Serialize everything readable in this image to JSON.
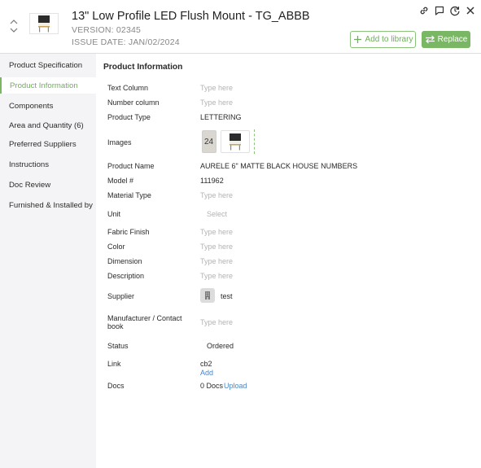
{
  "header": {
    "title": "13\" Low Profile LED Flush Mount - TG_ABBB",
    "version": "VERSION: 02345",
    "issue_date": "ISSUE DATE: JAN/02/2024",
    "add_to_library_label": "Add to library",
    "replace_label": "Replace"
  },
  "sidebar": {
    "items": [
      {
        "label": "Product Specification"
      },
      {
        "label": "Product Information"
      },
      {
        "label": "Components"
      },
      {
        "label": "Area and Quantity (6)"
      },
      {
        "label": "Preferred Suppliers"
      },
      {
        "label": "Instructions"
      },
      {
        "label": "Doc Review"
      },
      {
        "label": "Furnished & Installed by"
      }
    ],
    "active_index": 1
  },
  "main": {
    "section_title": "Product Information",
    "fields": {
      "text_column": {
        "label": "Text Column",
        "placeholder": "Type here"
      },
      "number_column": {
        "label": "Number column",
        "placeholder": "Type here"
      },
      "product_type": {
        "label": "Product Type",
        "value": "LETTERING"
      },
      "images": {
        "label": "Images",
        "image1_text": "24"
      },
      "product_name": {
        "label": "Product Name",
        "value": "AURELE 6\" MATTE BLACK HOUSE NUMBERS"
      },
      "model": {
        "label": "Model #",
        "value": "111962"
      },
      "material_type": {
        "label": "Material Type",
        "placeholder": "Type here"
      },
      "unit": {
        "label": "Unit",
        "placeholder": "Select"
      },
      "fabric_finish": {
        "label": "Fabric Finish",
        "placeholder": "Type here"
      },
      "color": {
        "label": "Color",
        "placeholder": "Type here"
      },
      "dimension": {
        "label": "Dimension",
        "placeholder": "Type here"
      },
      "description": {
        "label": "Description",
        "placeholder": "Type here"
      },
      "supplier": {
        "label": "Supplier",
        "value": "test"
      },
      "manufacturer": {
        "label_line1": "Manufacturer / Contact",
        "label_line2": "book",
        "placeholder": "Type here"
      },
      "status": {
        "label": "Status",
        "value": "Ordered"
      },
      "link": {
        "label": "Link",
        "value": "cb2",
        "add_label": "Add"
      },
      "docs": {
        "label": "Docs",
        "value": "0 Docs",
        "upload_label": "Upload"
      }
    }
  },
  "colors": {
    "accent_green": "#7ab764",
    "link_blue": "#4a86c8",
    "placeholder_gray": "#b3b3b3",
    "sidebar_bg": "#f4f4f6"
  }
}
